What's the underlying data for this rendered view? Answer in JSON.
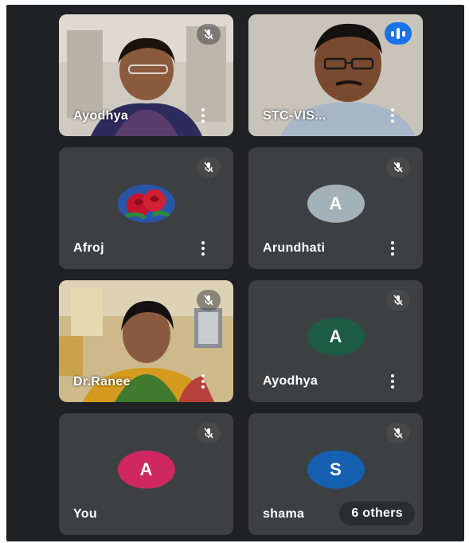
{
  "participants": [
    {
      "name": "Ayodhya",
      "type": "video",
      "muted": true
    },
    {
      "name": "STC-VIS...",
      "type": "video",
      "speaking": true
    },
    {
      "name": "Afroj",
      "type": "avatar-image",
      "muted": true
    },
    {
      "name": "Arundhati",
      "type": "avatar-letter",
      "letter": "A",
      "color": "#a3b1b8",
      "muted": true
    },
    {
      "name": "Dr.Ranee",
      "type": "video",
      "muted": true
    },
    {
      "name": "Ayodhya",
      "type": "avatar-letter",
      "letter": "A",
      "color": "#1e5b45",
      "muted": true
    },
    {
      "name": "You",
      "type": "avatar-letter",
      "letter": "A",
      "color": "#cf2860",
      "muted": true
    },
    {
      "name": "shama",
      "type": "avatar-letter",
      "letter": "S",
      "color": "#1560b0",
      "muted": true
    }
  ],
  "others_button": {
    "label": "6 others"
  },
  "colors": {
    "background": "#202124",
    "tile": "#3c4043",
    "speaking": "#1a73e8"
  }
}
